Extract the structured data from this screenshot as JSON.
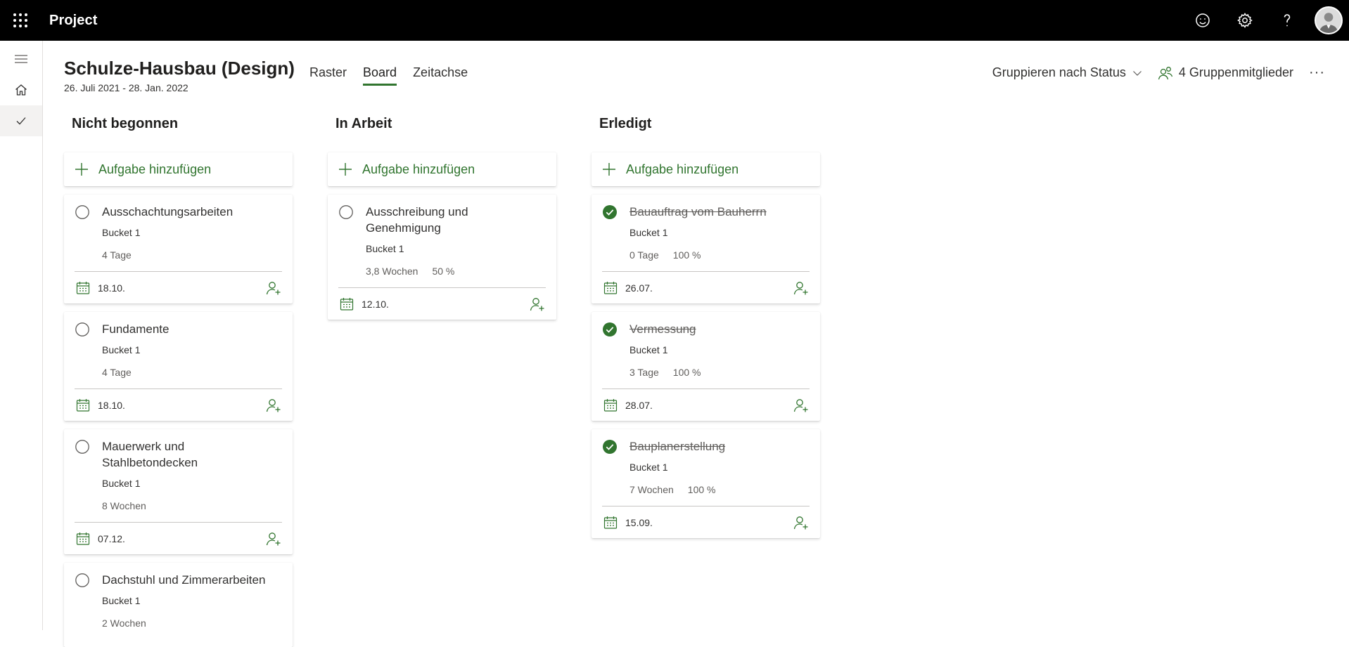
{
  "app": {
    "title": "Project"
  },
  "project": {
    "title": "Schulze-Hausbau (Design)",
    "dates": "26. Juli 2021 - 28. Jan. 2022"
  },
  "tabs": [
    {
      "label": "Raster"
    },
    {
      "label": "Board"
    },
    {
      "label": "Zeitachse"
    }
  ],
  "header": {
    "group_by": "Gruppieren nach Status",
    "members": "4 Gruppenmitglieder",
    "more": "···"
  },
  "board": {
    "add_task_label": "Aufgabe hinzufügen",
    "columns": [
      {
        "title": "Nicht begonnen",
        "tasks": [
          {
            "name": "Ausschachtungsarbeiten",
            "bucket": "Bucket 1",
            "duration": "4 Tage",
            "percent": "",
            "date": "18.10."
          },
          {
            "name": "Fundamente",
            "bucket": "Bucket 1",
            "duration": "4 Tage",
            "percent": "",
            "date": "18.10."
          },
          {
            "name": "Mauerwerk und Stahlbetondecken",
            "bucket": "Bucket 1",
            "duration": "8 Wochen",
            "percent": "",
            "date": "07.12."
          },
          {
            "name": "Dachstuhl und Zimmerarbeiten",
            "bucket": "Bucket 1",
            "duration": "2 Wochen",
            "percent": "",
            "date": ""
          }
        ]
      },
      {
        "title": "In Arbeit",
        "tasks": [
          {
            "name": "Ausschreibung und Genehmigung",
            "bucket": "Bucket 1",
            "duration": "3,8 Wochen",
            "percent": "50 %",
            "date": "12.10."
          }
        ]
      },
      {
        "title": "Erledigt",
        "tasks": [
          {
            "name": "Bauauftrag vom Bauherrn",
            "bucket": "Bucket 1",
            "duration": "0 Tage",
            "percent": "100 %",
            "date": "26.07."
          },
          {
            "name": "Vermessung",
            "bucket": "Bucket 1",
            "duration": "3 Tage",
            "percent": "100 %",
            "date": "28.07."
          },
          {
            "name": "Bauplanerstellung",
            "bucket": "Bucket 1",
            "duration": "7 Wochen",
            "percent": "100 %",
            "date": "15.09."
          }
        ]
      }
    ]
  },
  "colors": {
    "accent": "#31752f",
    "topbar": "#000000"
  },
  "icons": [
    "waffle-icon",
    "smiley-icon",
    "gear-icon",
    "help-icon",
    "hamburger-icon",
    "home-icon",
    "checkmark-icon",
    "chevron-down-icon",
    "people-icon",
    "plus-icon",
    "calendar-icon",
    "assign-person-icon"
  ]
}
